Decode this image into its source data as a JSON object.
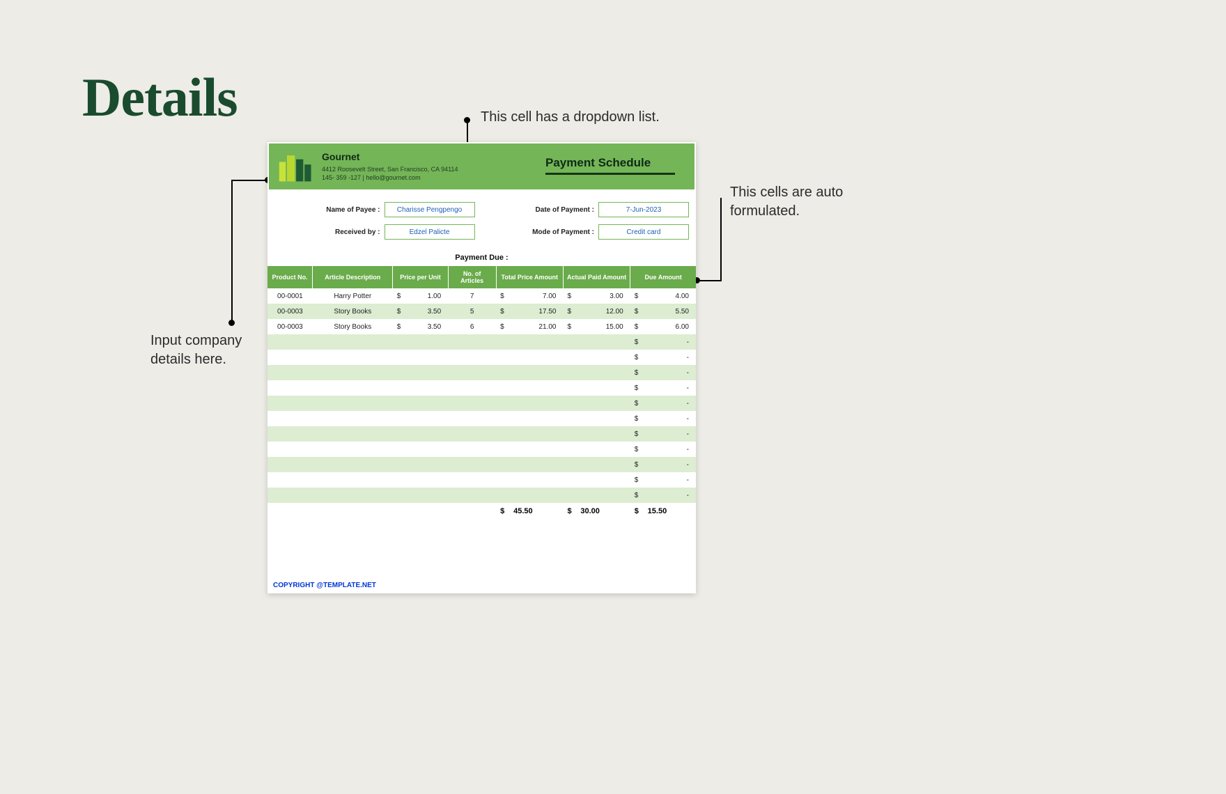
{
  "page": {
    "title": "Details"
  },
  "annotations": {
    "top": "This cell has a dropdown list.",
    "right_l1": "This cells are auto",
    "right_l2": "formulated.",
    "left_l1": "Input company",
    "left_l2": "details here."
  },
  "company": {
    "name": "Gournet",
    "address": "4412 Roosevelt Street, San Francisco, CA 94114",
    "contact": "145- 359 -127 | hello@gournet.com"
  },
  "doc": {
    "title": "Payment Schedule"
  },
  "meta": {
    "payee_label": "Name of Payee :",
    "payee": "Charisse Pengpengo",
    "received_label": "Received by :",
    "received": "Edzel Palicte",
    "date_label": "Date of Payment :",
    "date": "7-Jun-2023",
    "mode_label": "Mode of Payment :",
    "mode": "Credit card",
    "payment_due_label": "Payment Due :"
  },
  "table": {
    "headers": {
      "c1": "Product No.",
      "c2": "Article Description",
      "c3": "Price per Unit",
      "c4": "No. of Articles",
      "c5": "Total Price Amount",
      "c6": "Actual Paid Amount",
      "c7": "Due Amount"
    },
    "rows": [
      {
        "pn": "00-0001",
        "desc": "Harry Potter",
        "ppu": "1.00",
        "qty": "7",
        "tot": "7.00",
        "paid": "3.00",
        "due": "4.00"
      },
      {
        "pn": "00-0003",
        "desc": "Story Books",
        "ppu": "3.50",
        "qty": "5",
        "tot": "17.50",
        "paid": "12.00",
        "due": "5.50"
      },
      {
        "pn": "00-0003",
        "desc": "Story Books",
        "ppu": "3.50",
        "qty": "6",
        "tot": "21.00",
        "paid": "15.00",
        "due": "6.00"
      }
    ],
    "empty_rows": 11,
    "totals": {
      "tot": "45.50",
      "paid": "30.00",
      "due": "15.50"
    }
  },
  "footer": {
    "copyright": "COPYRIGHT @TEMPLATE.NET"
  },
  "chart_data": {
    "type": "table",
    "title": "Payment Schedule",
    "columns": [
      "Product No.",
      "Article Description",
      "Price per Unit",
      "No. of Articles",
      "Total Price Amount",
      "Actual Paid Amount",
      "Due Amount"
    ],
    "rows": [
      [
        "00-0001",
        "Harry Potter",
        1.0,
        7,
        7.0,
        3.0,
        4.0
      ],
      [
        "00-0003",
        "Story Books",
        3.5,
        5,
        17.5,
        12.0,
        5.5
      ],
      [
        "00-0003",
        "Story Books",
        3.5,
        6,
        21.0,
        15.0,
        6.0
      ]
    ],
    "totals": {
      "Total Price Amount": 45.5,
      "Actual Paid Amount": 30.0,
      "Due Amount": 15.5
    }
  }
}
